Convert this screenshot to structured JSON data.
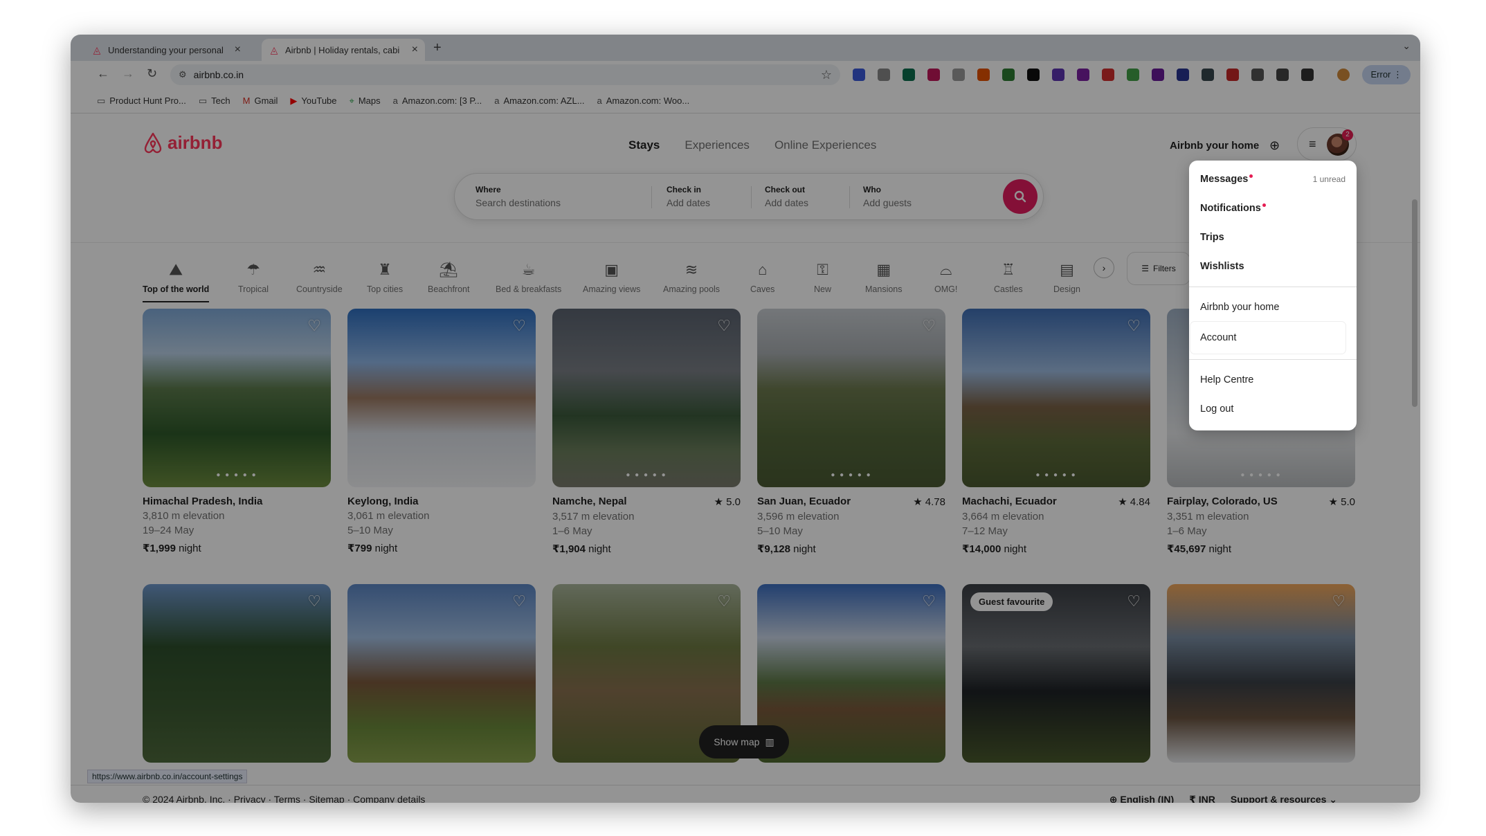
{
  "browser": {
    "tabs": [
      {
        "title": "Understanding your personal",
        "active": false
      },
      {
        "title": "Airbnb | Holiday rentals, cabi",
        "active": true
      }
    ],
    "url": "airbnb.co.in",
    "error_button": "Error",
    "bookmarks": [
      "Product Hunt Pro...",
      "Tech",
      "Gmail",
      "YouTube",
      "Maps",
      "Amazon.com: [3 P...",
      "Amazon.com: AZL...",
      "Amazon.com: Woo..."
    ],
    "status_url": "https://www.airbnb.co.in/account-settings"
  },
  "header": {
    "logo": "airbnb",
    "nav": [
      "Stays",
      "Experiences",
      "Online Experiences"
    ],
    "host_link": "Airbnb your home",
    "notification_badge": "2"
  },
  "search": {
    "where_label": "Where",
    "where_placeholder": "Search destinations",
    "checkin_label": "Check in",
    "checkin_placeholder": "Add dates",
    "checkout_label": "Check out",
    "checkout_placeholder": "Add dates",
    "who_label": "Who",
    "who_placeholder": "Add guests"
  },
  "categories": [
    "Top of the world",
    "Tropical",
    "Countryside",
    "Top cities",
    "Beachfront",
    "Bed & breakfasts",
    "Amazing views",
    "Amazing pools",
    "Caves",
    "New",
    "Mansions",
    "OMG!",
    "Castles",
    "Design"
  ],
  "filters_label": "Filters",
  "listings": [
    {
      "location": "Himachal Pradesh, India",
      "rating": "",
      "elevation": "3,810 m elevation",
      "dates": "19–24 May",
      "price": "₹1,999",
      "unit": "night"
    },
    {
      "location": "Keylong, India",
      "rating": "",
      "elevation": "3,061 m elevation",
      "dates": "5–10 May",
      "price": "₹799",
      "unit": "night"
    },
    {
      "location": "Namche, Nepal",
      "rating": "★ 5.0",
      "elevation": "3,517 m elevation",
      "dates": "1–6 May",
      "price": "₹1,904",
      "unit": "night"
    },
    {
      "location": "San Juan, Ecuador",
      "rating": "★ 4.78",
      "elevation": "3,596 m elevation",
      "dates": "5–10 May",
      "price": "₹9,128",
      "unit": "night"
    },
    {
      "location": "Machachi, Ecuador",
      "rating": "★ 4.84",
      "elevation": "3,664 m elevation",
      "dates": "7–12 May",
      "price": "₹14,000",
      "unit": "night"
    },
    {
      "location": "Fairplay, Colorado, US",
      "rating": "★ 5.0",
      "elevation": "3,351 m elevation",
      "dates": "1–6 May",
      "price": "₹45,697",
      "unit": "night"
    }
  ],
  "guest_favourite": "Guest favourite",
  "show_map": "Show map",
  "footer": {
    "left": "© 2024 Airbnb, Inc. · Privacy · Terms · Sitemap · Company details",
    "language": "English (IN)",
    "currency": "₹ INR",
    "support": "Support & resources"
  },
  "menu": {
    "messages": "Messages",
    "messages_count": "1 unread",
    "notifications": "Notifications",
    "trips": "Trips",
    "wishlists": "Wishlists",
    "host": "Airbnb your home",
    "account": "Account",
    "help": "Help Centre",
    "logout": "Log out"
  }
}
